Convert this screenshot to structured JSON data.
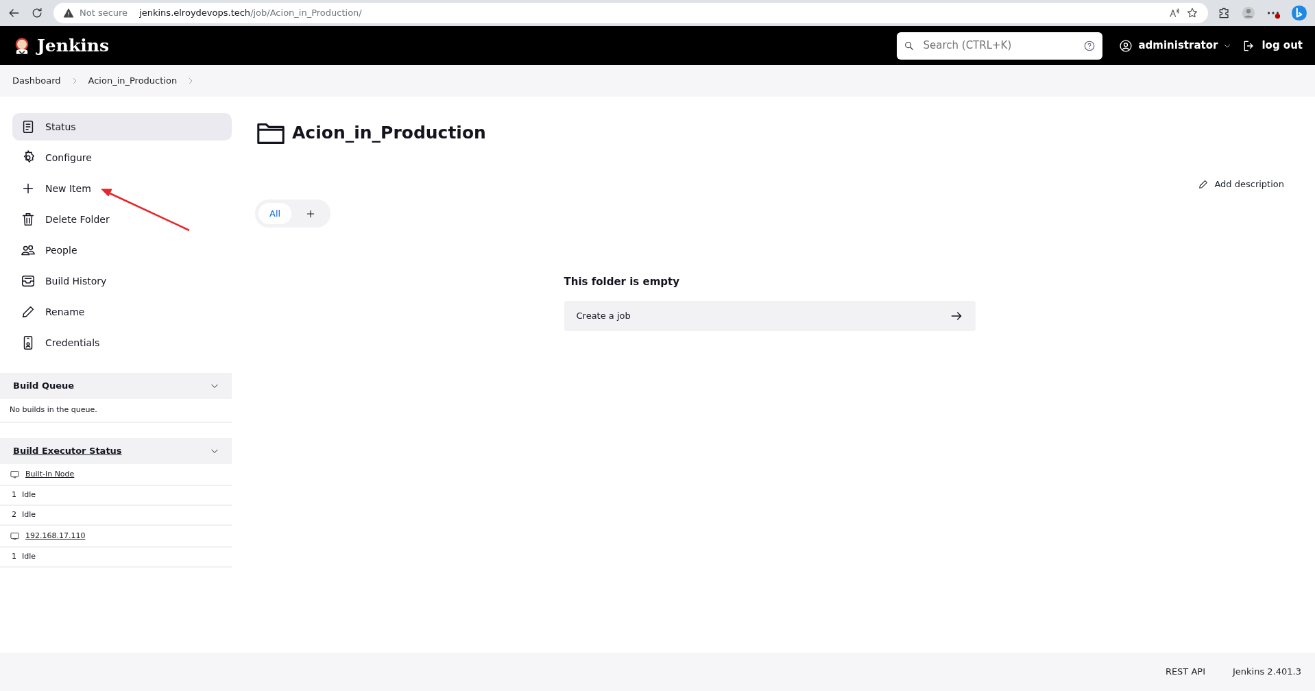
{
  "browser": {
    "security_label": "Not secure",
    "url_host": "jenkins.elroydevops.tech",
    "url_path": "/job/Acion_in_Production/"
  },
  "header": {
    "brand": "Jenkins",
    "search_placeholder": "Search (CTRL+K)",
    "user": "administrator",
    "logout": "log out"
  },
  "breadcrumbs": [
    "Dashboard",
    "Acion_in_Production"
  ],
  "sidebar": {
    "items": [
      {
        "kind": "status",
        "label": "Status",
        "selected": true
      },
      {
        "kind": "configure",
        "label": "Configure",
        "selected": false
      },
      {
        "kind": "new",
        "label": "New Item",
        "selected": false
      },
      {
        "kind": "delete",
        "label": "Delete Folder",
        "selected": false
      },
      {
        "kind": "people",
        "label": "People",
        "selected": false
      },
      {
        "kind": "history",
        "label": "Build History",
        "selected": false
      },
      {
        "kind": "rename",
        "label": "Rename",
        "selected": false
      },
      {
        "kind": "credentials",
        "label": "Credentials",
        "selected": false
      }
    ]
  },
  "build_queue": {
    "title": "Build Queue",
    "expanded": true,
    "message": "No builds in the queue."
  },
  "executor_status": {
    "title": "Build Executor Status",
    "expanded": true,
    "nodes": [
      {
        "name": "Built-In Node",
        "executors": [
          {
            "number": "1",
            "state": "Idle"
          },
          {
            "number": "2",
            "state": "Idle"
          }
        ]
      },
      {
        "name": "192.168.17.110",
        "executors": [
          {
            "number": "1",
            "state": "Idle"
          }
        ]
      }
    ]
  },
  "main": {
    "title": "Acion_in_Production",
    "add_description": "Add description",
    "views": [
      {
        "label": "All",
        "selected": true
      }
    ],
    "empty_heading": "This folder is empty",
    "create_job": "Create a job"
  },
  "footer": {
    "links": [
      "REST API",
      "Jenkins 2.401.3"
    ]
  }
}
